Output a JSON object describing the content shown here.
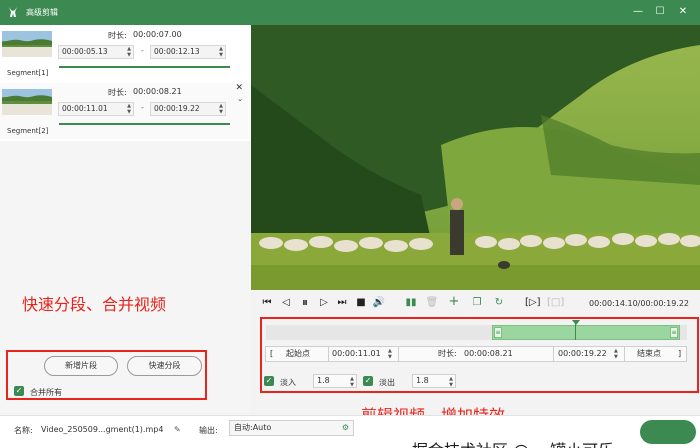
{
  "window": {
    "title": "高级剪辑",
    "logo_icon": "rabbit-logo-icon"
  },
  "segments": [
    {
      "label": "Segment[1]",
      "duration_label": "时长:",
      "duration": "00:00:07.00",
      "start": "00:00:05.13",
      "end": "00:00:12.13"
    },
    {
      "label": "Segment[2]",
      "duration_label": "时长:",
      "duration": "00:00:08.21",
      "start": "00:00:11.01",
      "end": "00:00:19.22"
    }
  ],
  "segment_separator": "-",
  "annotations": {
    "left": "快速分段、合并视频",
    "right": "剪辑视频、增加特效"
  },
  "left_actions": {
    "add_segment": "新增片段",
    "quick_split": "快速分段",
    "merge_all": "合并所有",
    "merge_all_checked": true
  },
  "player": {
    "current_time": "00:00:14.10",
    "total_time": "00:00:19.22"
  },
  "clip": {
    "start_point_label": "起始点",
    "start": "00:00:11.01",
    "duration_label": "时长:",
    "duration": "00:00:08.21",
    "end": "00:00:19.22",
    "end_point_label": "结束点",
    "bracket_open": "[",
    "bracket_close": "]"
  },
  "fade": {
    "fade_in_label": "淡入",
    "fade_in_value": "1.8",
    "fade_in_checked": true,
    "fade_out_label": "淡出",
    "fade_out_value": "1.8",
    "fade_out_checked": true
  },
  "bottom": {
    "name_label": "名称:",
    "file_name": "Video_250509...gment(1).mp4",
    "output_label": "输出:",
    "output_value": "自动:Auto"
  },
  "watermark": "掘金技术社区 @ 一罐小可乐",
  "colors": {
    "accent": "#3c8a52",
    "annotation_red": "#e8241c",
    "timeline_selection": "#9bd5a0"
  }
}
